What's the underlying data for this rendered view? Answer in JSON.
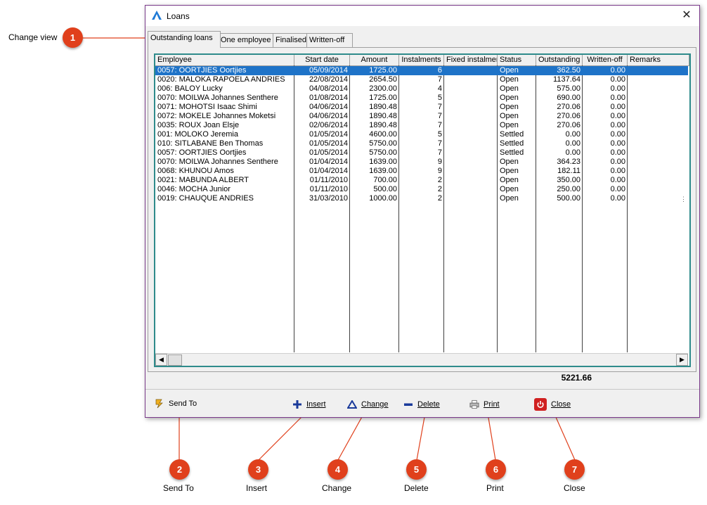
{
  "window": {
    "title": "Loans",
    "tabs": [
      "Outstanding loans",
      "One employee",
      "Finalised",
      "Written-off"
    ],
    "active_tab": 0
  },
  "grid": {
    "columns": [
      "Employee",
      "Start date",
      "Amount",
      "Instalments",
      "Fixed instalment",
      "Status",
      "Outstanding",
      "Written-off",
      "Remarks"
    ],
    "rows": [
      [
        "0057: OORTJIES Oortjies",
        "05/09/2014",
        "1725.00",
        "6",
        "",
        "Open",
        "362.50",
        "0.00",
        ""
      ],
      [
        "0020: MALOKA RAPOELA ANDRIES",
        "22/08/2014",
        "2654.50",
        "7",
        "",
        "Open",
        "1137.64",
        "0.00",
        ""
      ],
      [
        "006: BALOY Lucky",
        "04/08/2014",
        "2300.00",
        "4",
        "",
        "Open",
        "575.00",
        "0.00",
        ""
      ],
      [
        "0070: MOILWA Johannes Senthere",
        "01/08/2014",
        "1725.00",
        "5",
        "",
        "Open",
        "690.00",
        "0.00",
        ""
      ],
      [
        "0071: MOHOTSI Isaac Shimi",
        "04/06/2014",
        "1890.48",
        "7",
        "",
        "Open",
        "270.06",
        "0.00",
        ""
      ],
      [
        "0072: MOKELE Johannes Moketsi",
        "04/06/2014",
        "1890.48",
        "7",
        "",
        "Open",
        "270.06",
        "0.00",
        ""
      ],
      [
        "0035: ROUX Joan Elsje",
        "02/06/2014",
        "1890.48",
        "7",
        "",
        "Open",
        "270.06",
        "0.00",
        ""
      ],
      [
        "001: MOLOKO Jeremia",
        "01/05/2014",
        "4600.00",
        "5",
        "",
        "Settled",
        "0.00",
        "0.00",
        ""
      ],
      [
        "010: SITLABANE Ben Thomas",
        "01/05/2014",
        "5750.00",
        "7",
        "",
        "Settled",
        "0.00",
        "0.00",
        ""
      ],
      [
        "0057: OORTJIES Oortjies",
        "01/05/2014",
        "5750.00",
        "7",
        "",
        "Settled",
        "0.00",
        "0.00",
        ""
      ],
      [
        "0070: MOILWA Johannes Senthere",
        "01/04/2014",
        "1639.00",
        "9",
        "",
        "Open",
        "364.23",
        "0.00",
        ""
      ],
      [
        "0068: KHUNOU Amos",
        "01/04/2014",
        "1639.00",
        "9",
        "",
        "Open",
        "182.11",
        "0.00",
        ""
      ],
      [
        "0021: MABUNDA ALBERT",
        "01/11/2010",
        "700.00",
        "2",
        "",
        "Open",
        "350.00",
        "0.00",
        ""
      ],
      [
        "0046: MOCHA Junior",
        "01/11/2010",
        "500.00",
        "2",
        "",
        "Open",
        "250.00",
        "0.00",
        ""
      ],
      [
        "0019: CHAUQUE ANDRIES",
        "31/03/2010",
        "1000.00",
        "2",
        "",
        "Open",
        "500.00",
        "0.00",
        ""
      ]
    ],
    "selected_row": 0,
    "total_outstanding": "5221.66"
  },
  "toolbar": {
    "send_to": "Send To",
    "insert": "Insert",
    "change": "Change",
    "delete": "Delete",
    "print": "Print",
    "close": "Close"
  },
  "callouts": [
    {
      "num": "1",
      "label": "Change view"
    },
    {
      "num": "2",
      "label": "Send To"
    },
    {
      "num": "3",
      "label": "Insert"
    },
    {
      "num": "4",
      "label": "Change"
    },
    {
      "num": "5",
      "label": "Delete"
    },
    {
      "num": "6",
      "label": "Print"
    },
    {
      "num": "7",
      "label": "Close"
    }
  ],
  "colors": {
    "callout": "#e0401c",
    "selection": "#1e73c8",
    "grid_border": "#2e8b8b",
    "window_border": "#7a3a8a"
  }
}
